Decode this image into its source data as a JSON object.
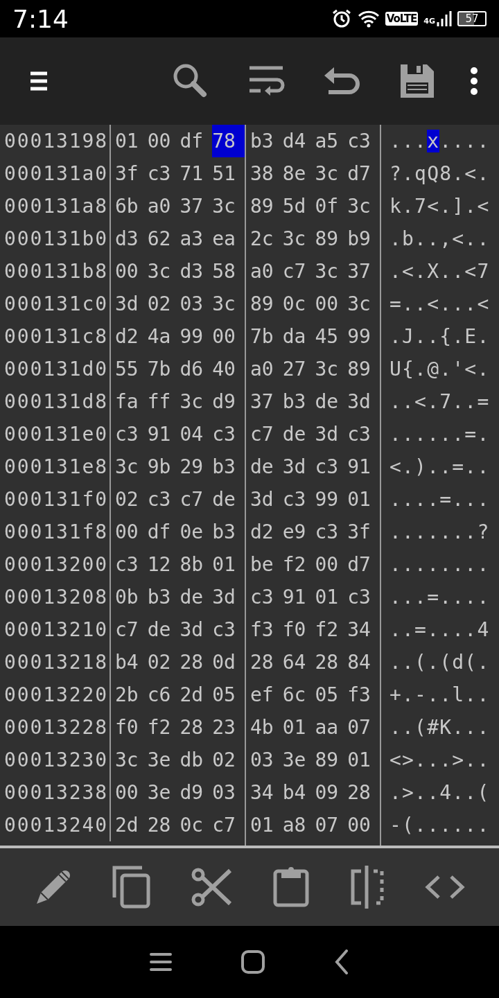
{
  "status_bar": {
    "time": "7:14",
    "volte": "VoLTE",
    "network": "4G",
    "battery": "57"
  },
  "rows": [
    {
      "address": "00013198",
      "bytes": [
        {
          "hex": "01",
          "selected": false
        },
        {
          "hex": "00",
          "selected": false
        },
        {
          "hex": "df",
          "selected": false
        },
        {
          "hex": "78",
          "selected": true
        },
        {
          "hex": "b3",
          "selected": false
        },
        {
          "hex": "d4",
          "selected": false
        },
        {
          "hex": "a5",
          "selected": false
        },
        {
          "hex": "c3",
          "selected": false
        }
      ],
      "ascii": "...x...."
    },
    {
      "address": "000131a0",
      "bytes": [
        {
          "hex": "3f",
          "selected": false
        },
        {
          "hex": "c3",
          "selected": false
        },
        {
          "hex": "71",
          "selected": false
        },
        {
          "hex": "51",
          "selected": false
        },
        {
          "hex": "38",
          "selected": false
        },
        {
          "hex": "8e",
          "selected": false
        },
        {
          "hex": "3c",
          "selected": false
        },
        {
          "hex": "d7",
          "selected": false
        }
      ],
      "ascii": "?.qQ8.<."
    },
    {
      "address": "000131a8",
      "bytes": [
        {
          "hex": "6b",
          "selected": false
        },
        {
          "hex": "a0",
          "selected": false
        },
        {
          "hex": "37",
          "selected": false
        },
        {
          "hex": "3c",
          "selected": false
        },
        {
          "hex": "89",
          "selected": false
        },
        {
          "hex": "5d",
          "selected": false
        },
        {
          "hex": "0f",
          "selected": false
        },
        {
          "hex": "3c",
          "selected": false
        }
      ],
      "ascii": "k.7<.].<"
    },
    {
      "address": "000131b0",
      "bytes": [
        {
          "hex": "d3",
          "selected": false
        },
        {
          "hex": "62",
          "selected": false
        },
        {
          "hex": "a3",
          "selected": false
        },
        {
          "hex": "ea",
          "selected": false
        },
        {
          "hex": "2c",
          "selected": false
        },
        {
          "hex": "3c",
          "selected": false
        },
        {
          "hex": "89",
          "selected": false
        },
        {
          "hex": "b9",
          "selected": false
        }
      ],
      "ascii": ".b..,<.."
    },
    {
      "address": "000131b8",
      "bytes": [
        {
          "hex": "00",
          "selected": false
        },
        {
          "hex": "3c",
          "selected": false
        },
        {
          "hex": "d3",
          "selected": false
        },
        {
          "hex": "58",
          "selected": false
        },
        {
          "hex": "a0",
          "selected": false
        },
        {
          "hex": "c7",
          "selected": false
        },
        {
          "hex": "3c",
          "selected": false
        },
        {
          "hex": "37",
          "selected": false
        }
      ],
      "ascii": ".<.X..<7"
    },
    {
      "address": "000131c0",
      "bytes": [
        {
          "hex": "3d",
          "selected": false
        },
        {
          "hex": "02",
          "selected": false
        },
        {
          "hex": "03",
          "selected": false
        },
        {
          "hex": "3c",
          "selected": false
        },
        {
          "hex": "89",
          "selected": false
        },
        {
          "hex": "0c",
          "selected": false
        },
        {
          "hex": "00",
          "selected": false
        },
        {
          "hex": "3c",
          "selected": false
        }
      ],
      "ascii": "=..<...<"
    },
    {
      "address": "000131c8",
      "bytes": [
        {
          "hex": "d2",
          "selected": false
        },
        {
          "hex": "4a",
          "selected": false
        },
        {
          "hex": "99",
          "selected": false
        },
        {
          "hex": "00",
          "selected": false
        },
        {
          "hex": "7b",
          "selected": false
        },
        {
          "hex": "da",
          "selected": false
        },
        {
          "hex": "45",
          "selected": false
        },
        {
          "hex": "99",
          "selected": false
        }
      ],
      "ascii": ".J..{.E."
    },
    {
      "address": "000131d0",
      "bytes": [
        {
          "hex": "55",
          "selected": false
        },
        {
          "hex": "7b",
          "selected": false
        },
        {
          "hex": "d6",
          "selected": false
        },
        {
          "hex": "40",
          "selected": false
        },
        {
          "hex": "a0",
          "selected": false
        },
        {
          "hex": "27",
          "selected": false
        },
        {
          "hex": "3c",
          "selected": false
        },
        {
          "hex": "89",
          "selected": false
        }
      ],
      "ascii": "U{.@.'<."
    },
    {
      "address": "000131d8",
      "bytes": [
        {
          "hex": "fa",
          "selected": false
        },
        {
          "hex": "ff",
          "selected": false
        },
        {
          "hex": "3c",
          "selected": false
        },
        {
          "hex": "d9",
          "selected": false
        },
        {
          "hex": "37",
          "selected": false
        },
        {
          "hex": "b3",
          "selected": false
        },
        {
          "hex": "de",
          "selected": false
        },
        {
          "hex": "3d",
          "selected": false
        }
      ],
      "ascii": "..<.7..="
    },
    {
      "address": "000131e0",
      "bytes": [
        {
          "hex": "c3",
          "selected": false
        },
        {
          "hex": "91",
          "selected": false
        },
        {
          "hex": "04",
          "selected": false
        },
        {
          "hex": "c3",
          "selected": false
        },
        {
          "hex": "c7",
          "selected": false
        },
        {
          "hex": "de",
          "selected": false
        },
        {
          "hex": "3d",
          "selected": false
        },
        {
          "hex": "c3",
          "selected": false
        }
      ],
      "ascii": "......=."
    },
    {
      "address": "000131e8",
      "bytes": [
        {
          "hex": "3c",
          "selected": false
        },
        {
          "hex": "9b",
          "selected": false
        },
        {
          "hex": "29",
          "selected": false
        },
        {
          "hex": "b3",
          "selected": false
        },
        {
          "hex": "de",
          "selected": false
        },
        {
          "hex": "3d",
          "selected": false
        },
        {
          "hex": "c3",
          "selected": false
        },
        {
          "hex": "91",
          "selected": false
        }
      ],
      "ascii": "<.)..=.."
    },
    {
      "address": "000131f0",
      "bytes": [
        {
          "hex": "02",
          "selected": false
        },
        {
          "hex": "c3",
          "selected": false
        },
        {
          "hex": "c7",
          "selected": false
        },
        {
          "hex": "de",
          "selected": false
        },
        {
          "hex": "3d",
          "selected": false
        },
        {
          "hex": "c3",
          "selected": false
        },
        {
          "hex": "99",
          "selected": false
        },
        {
          "hex": "01",
          "selected": false
        }
      ],
      "ascii": "....=..."
    },
    {
      "address": "000131f8",
      "bytes": [
        {
          "hex": "00",
          "selected": false
        },
        {
          "hex": "df",
          "selected": false
        },
        {
          "hex": "0e",
          "selected": false
        },
        {
          "hex": "b3",
          "selected": false
        },
        {
          "hex": "d2",
          "selected": false
        },
        {
          "hex": "e9",
          "selected": false
        },
        {
          "hex": "c3",
          "selected": false
        },
        {
          "hex": "3f",
          "selected": false
        }
      ],
      "ascii": ".......?"
    },
    {
      "address": "00013200",
      "bytes": [
        {
          "hex": "c3",
          "selected": false
        },
        {
          "hex": "12",
          "selected": false
        },
        {
          "hex": "8b",
          "selected": false
        },
        {
          "hex": "01",
          "selected": false
        },
        {
          "hex": "be",
          "selected": false
        },
        {
          "hex": "f2",
          "selected": false
        },
        {
          "hex": "00",
          "selected": false
        },
        {
          "hex": "d7",
          "selected": false
        }
      ],
      "ascii": "........"
    },
    {
      "address": "00013208",
      "bytes": [
        {
          "hex": "0b",
          "selected": false
        },
        {
          "hex": "b3",
          "selected": false
        },
        {
          "hex": "de",
          "selected": false
        },
        {
          "hex": "3d",
          "selected": false
        },
        {
          "hex": "c3",
          "selected": false
        },
        {
          "hex": "91",
          "selected": false
        },
        {
          "hex": "01",
          "selected": false
        },
        {
          "hex": "c3",
          "selected": false
        }
      ],
      "ascii": "...=...."
    },
    {
      "address": "00013210",
      "bytes": [
        {
          "hex": "c7",
          "selected": false
        },
        {
          "hex": "de",
          "selected": false
        },
        {
          "hex": "3d",
          "selected": false
        },
        {
          "hex": "c3",
          "selected": false
        },
        {
          "hex": "f3",
          "selected": false
        },
        {
          "hex": "f0",
          "selected": false
        },
        {
          "hex": "f2",
          "selected": false
        },
        {
          "hex": "34",
          "selected": false
        }
      ],
      "ascii": "..=....4"
    },
    {
      "address": "00013218",
      "bytes": [
        {
          "hex": "b4",
          "selected": false
        },
        {
          "hex": "02",
          "selected": false
        },
        {
          "hex": "28",
          "selected": false
        },
        {
          "hex": "0d",
          "selected": false
        },
        {
          "hex": "28",
          "selected": false
        },
        {
          "hex": "64",
          "selected": false
        },
        {
          "hex": "28",
          "selected": false
        },
        {
          "hex": "84",
          "selected": false
        }
      ],
      "ascii": "..(.(d(."
    },
    {
      "address": "00013220",
      "bytes": [
        {
          "hex": "2b",
          "selected": false
        },
        {
          "hex": "c6",
          "selected": false
        },
        {
          "hex": "2d",
          "selected": false
        },
        {
          "hex": "05",
          "selected": false
        },
        {
          "hex": "ef",
          "selected": false
        },
        {
          "hex": "6c",
          "selected": false
        },
        {
          "hex": "05",
          "selected": false
        },
        {
          "hex": "f3",
          "selected": false
        }
      ],
      "ascii": "+.-..l.."
    },
    {
      "address": "00013228",
      "bytes": [
        {
          "hex": "f0",
          "selected": false
        },
        {
          "hex": "f2",
          "selected": false
        },
        {
          "hex": "28",
          "selected": false
        },
        {
          "hex": "23",
          "selected": false
        },
        {
          "hex": "4b",
          "selected": false
        },
        {
          "hex": "01",
          "selected": false
        },
        {
          "hex": "aa",
          "selected": false
        },
        {
          "hex": "07",
          "selected": false
        }
      ],
      "ascii": "..(#K..."
    },
    {
      "address": "00013230",
      "bytes": [
        {
          "hex": "3c",
          "selected": false
        },
        {
          "hex": "3e",
          "selected": false
        },
        {
          "hex": "db",
          "selected": false
        },
        {
          "hex": "02",
          "selected": false
        },
        {
          "hex": "03",
          "selected": false
        },
        {
          "hex": "3e",
          "selected": false
        },
        {
          "hex": "89",
          "selected": false
        },
        {
          "hex": "01",
          "selected": false
        }
      ],
      "ascii": "<>...>.."
    },
    {
      "address": "00013238",
      "bytes": [
        {
          "hex": "00",
          "selected": false
        },
        {
          "hex": "3e",
          "selected": false
        },
        {
          "hex": "d9",
          "selected": false
        },
        {
          "hex": "03",
          "selected": false
        },
        {
          "hex": "34",
          "selected": false
        },
        {
          "hex": "b4",
          "selected": false
        },
        {
          "hex": "09",
          "selected": false
        },
        {
          "hex": "28",
          "selected": false
        }
      ],
      "ascii": ".>..4..("
    },
    {
      "address": "00013240",
      "bytes": [
        {
          "hex": "2d",
          "selected": false
        },
        {
          "hex": "28",
          "selected": false
        },
        {
          "hex": "0c",
          "selected": false
        },
        {
          "hex": "c7",
          "selected": false
        },
        {
          "hex": "01",
          "selected": false
        },
        {
          "hex": "a8",
          "selected": false
        },
        {
          "hex": "07",
          "selected": false
        },
        {
          "hex": "00",
          "selected": false
        }
      ],
      "ascii": "-(......"
    }
  ]
}
